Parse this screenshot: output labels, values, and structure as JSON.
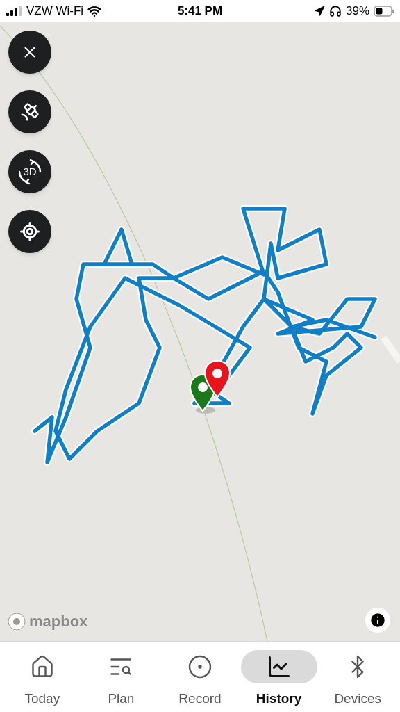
{
  "status_bar": {
    "carrier": "VZW Wi-Fi",
    "time": "5:41 PM",
    "battery": "39%"
  },
  "map": {
    "controls": [
      {
        "kind": "close"
      },
      {
        "kind": "satellite"
      },
      {
        "kind": "rotate",
        "label": "3D"
      },
      {
        "kind": "locate"
      }
    ],
    "logo": "mapbox"
  },
  "tabs": [
    {
      "label": "Today",
      "selected": false
    },
    {
      "label": "Plan",
      "selected": false
    },
    {
      "label": "Record",
      "selected": false
    },
    {
      "label": "History",
      "selected": true
    },
    {
      "label": "Devices",
      "selected": false
    }
  ]
}
